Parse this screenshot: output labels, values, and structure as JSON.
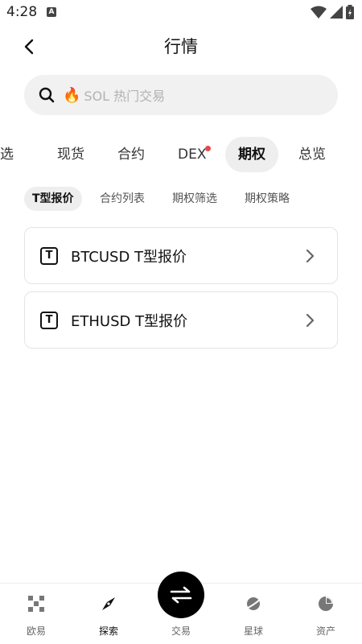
{
  "status_bar": {
    "time": "4:28",
    "app_indicator": "A"
  },
  "header": {
    "title": "行情",
    "back_icon": "chevron-left-icon"
  },
  "search": {
    "fire_icon": "🔥",
    "placeholder": "SOL 热门交易"
  },
  "main_tabs": [
    {
      "label": "自选",
      "active": false
    },
    {
      "label": "现货",
      "active": false
    },
    {
      "label": "合约",
      "active": false
    },
    {
      "label": "DEX",
      "active": false,
      "notification_dot": true
    },
    {
      "label": "期权",
      "active": true
    },
    {
      "label": "总览",
      "active": false
    }
  ],
  "sub_tabs": [
    {
      "label": "T型报价",
      "active": true
    },
    {
      "label": "合约列表",
      "active": false
    },
    {
      "label": "期权筛选",
      "active": false
    },
    {
      "label": "期权策略",
      "active": false
    }
  ],
  "cards": [
    {
      "icon": "T",
      "label": "BTCUSD T型报价"
    },
    {
      "icon": "T",
      "label": "ETHUSD T型报价"
    }
  ],
  "bottom_nav": [
    {
      "label": "欧易",
      "icon": "okx-logo-icon",
      "active": false
    },
    {
      "label": "探索",
      "icon": "compass-icon",
      "active": true
    },
    {
      "label": "交易",
      "icon": "swap-arrows-icon",
      "active": false
    },
    {
      "label": "星球",
      "icon": "planet-icon",
      "active": false
    },
    {
      "label": "资产",
      "icon": "pie-chart-icon",
      "active": false
    }
  ],
  "colors": {
    "accent_dot": "#e5484d",
    "tab_active_bg": "#eeeeee",
    "search_bg": "#f1f1f1"
  }
}
